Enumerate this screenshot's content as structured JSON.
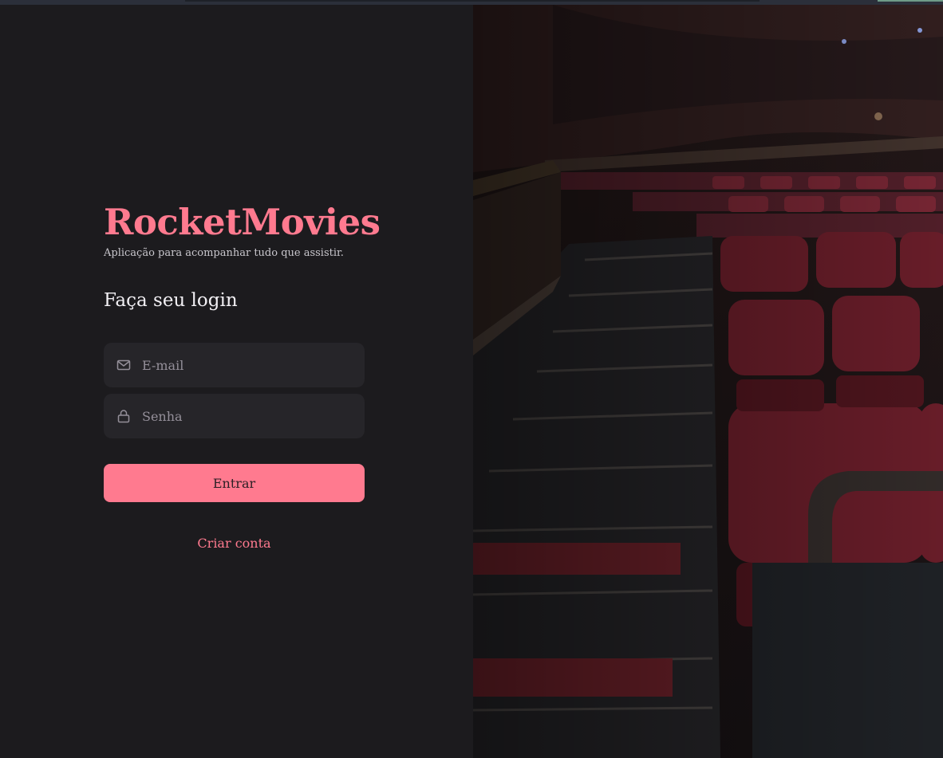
{
  "app": {
    "brand": "RocketMovies",
    "tagline": "Aplicação para acompanhar tudo que assistir."
  },
  "login": {
    "title": "Faça seu login",
    "email": {
      "placeholder": "E-mail",
      "value": "",
      "icon": "mail-icon"
    },
    "password": {
      "placeholder": "Senha",
      "value": "",
      "icon": "lock-icon"
    },
    "submit_label": "Entrar",
    "create_account_label": "Criar conta"
  },
  "colors": {
    "background": "#1c1b1e",
    "accent": "#ff7a8f",
    "input_bg": "#262529",
    "text": "#f2f0f4",
    "muted": "#948f99"
  },
  "background_image": {
    "subject": "cinema-auditorium-red-seats-stairs"
  }
}
